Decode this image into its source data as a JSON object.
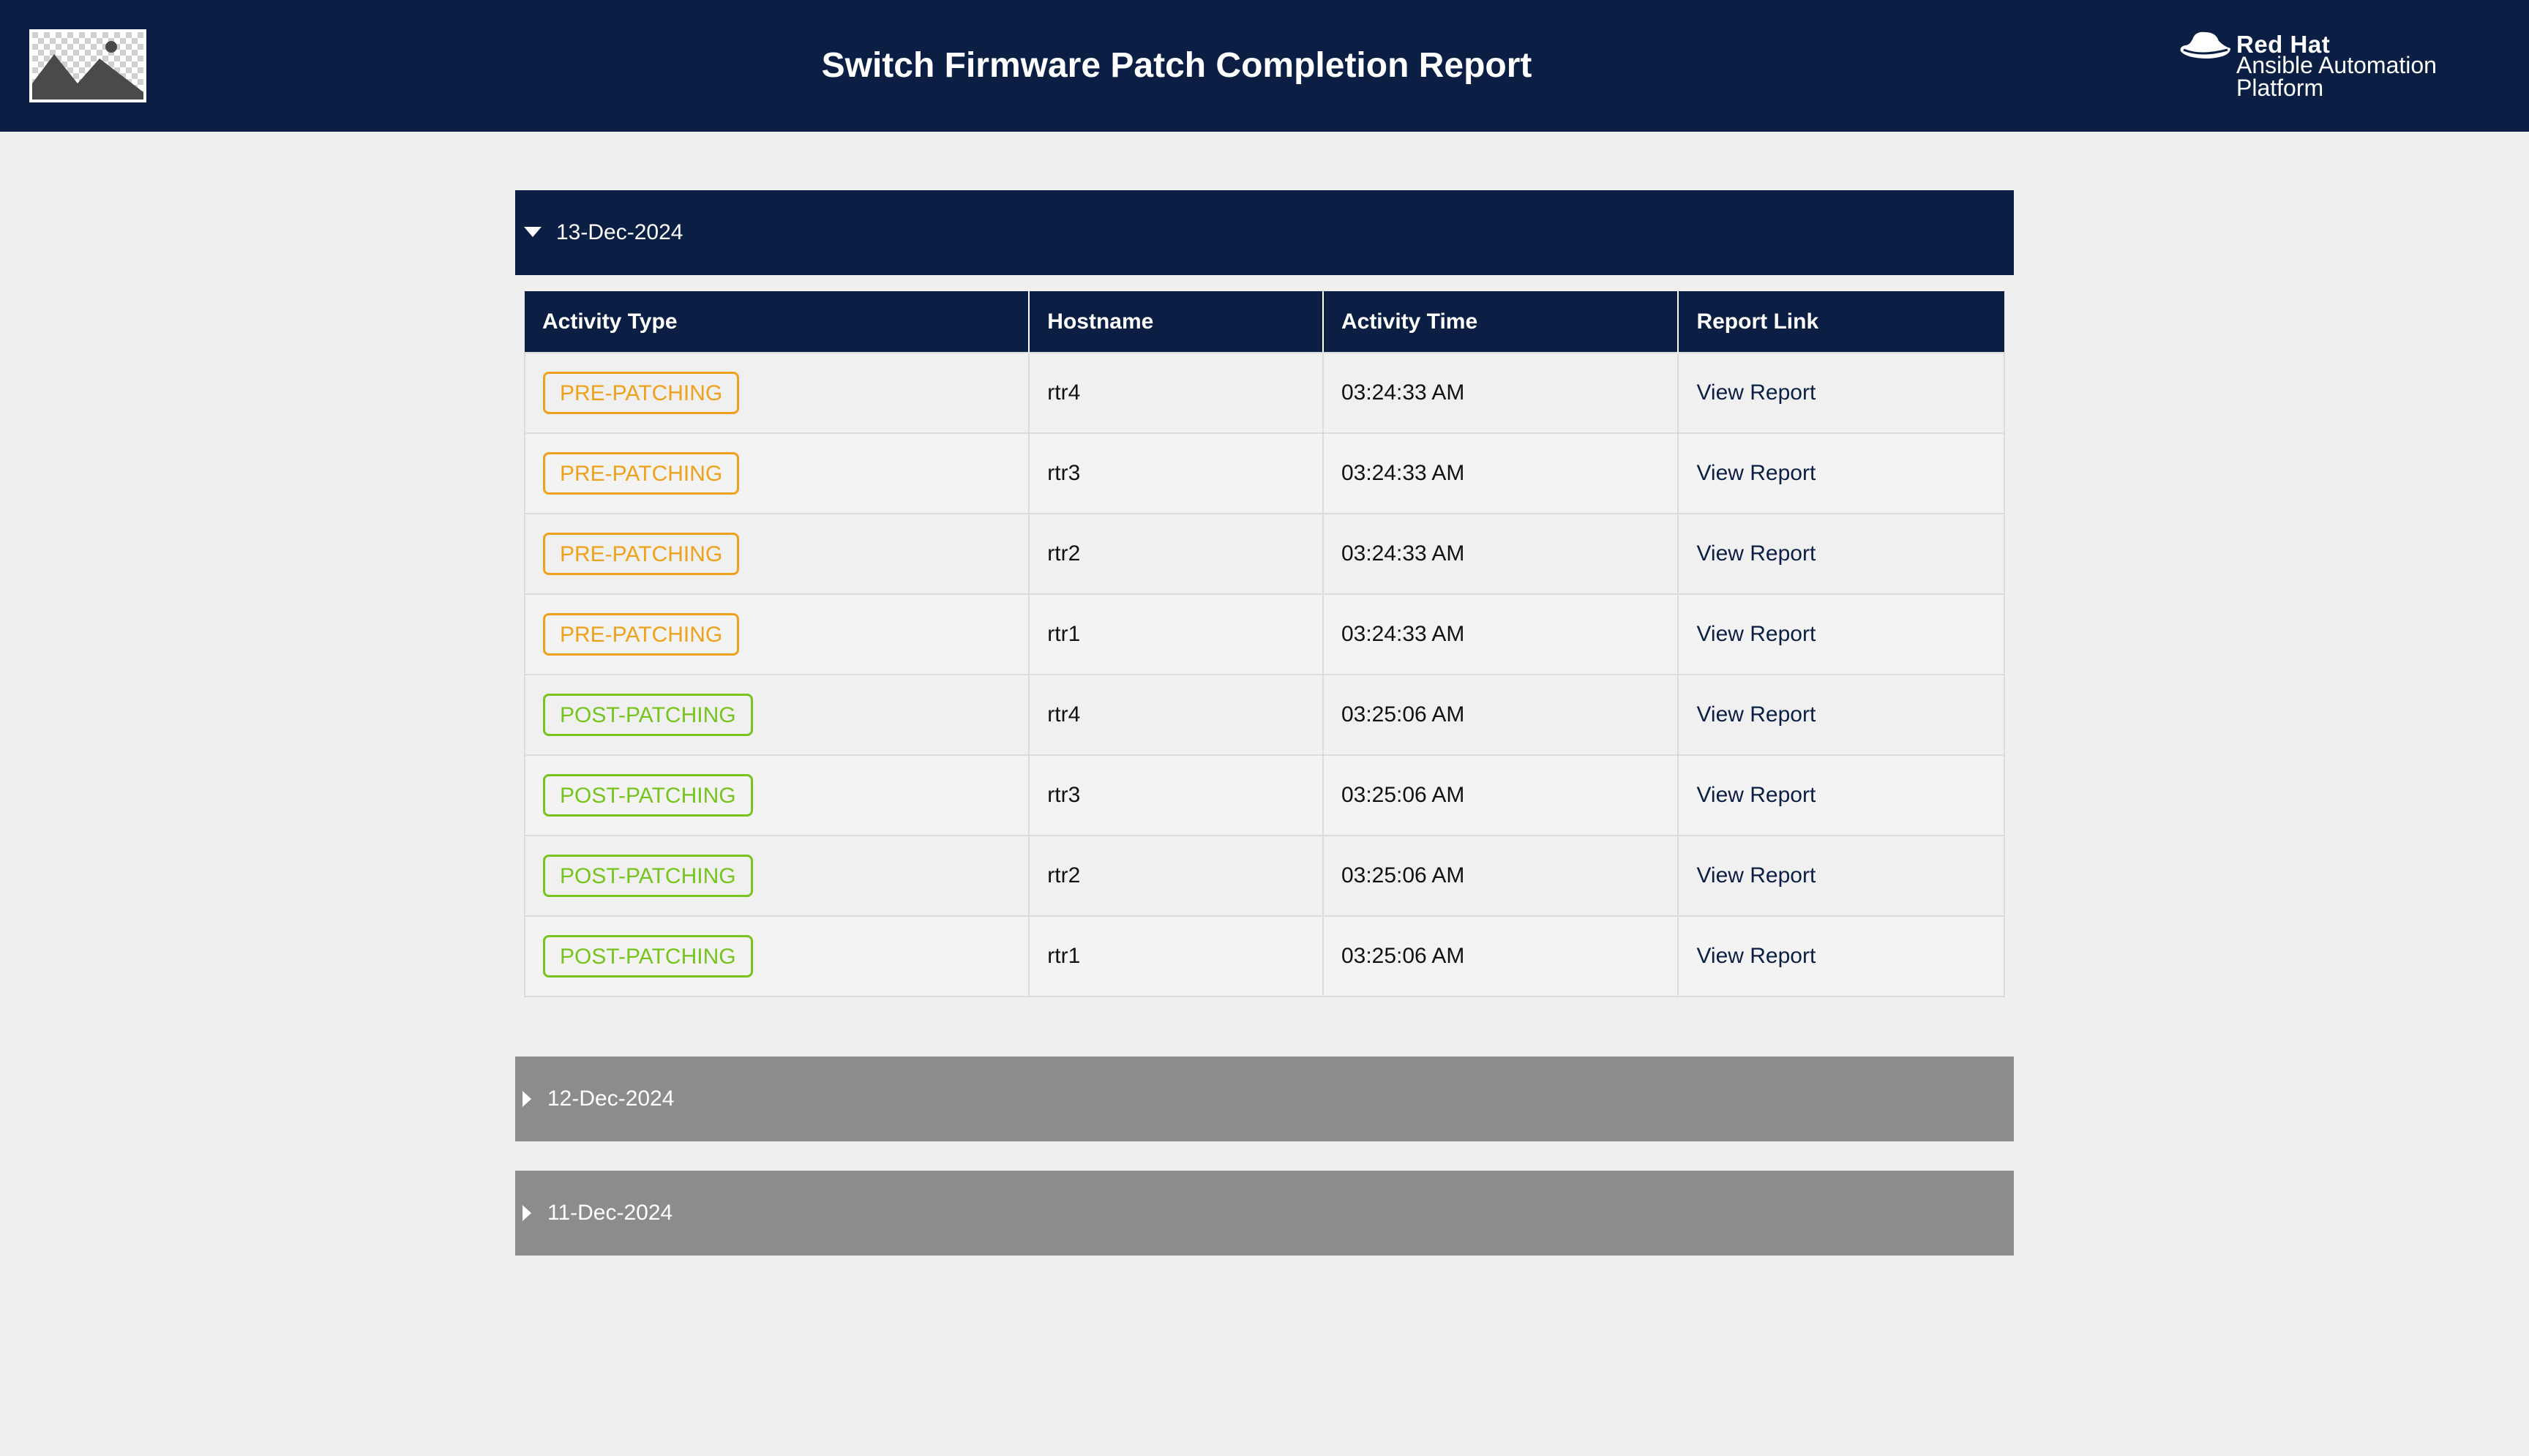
{
  "header": {
    "title": "Switch Firmware Patch Completion Report",
    "brand_name": "Red Hat",
    "brand_product": "Ansible Automation Platform",
    "logo_icon": "image-placeholder-icon"
  },
  "colors": {
    "navy": "#0b1f45",
    "collapsed_gray": "#8c8c8c",
    "pre_patching": "#f0a11c",
    "post_patching": "#77c41e"
  },
  "sections": [
    {
      "date": "13-Dec-2024",
      "expanded": true,
      "columns": [
        "Activity Type",
        "Hostname",
        "Activity Time",
        "Report Link"
      ],
      "rows": [
        {
          "activity": "PRE-PATCHING",
          "kind": "pre",
          "host": "rtr4",
          "time": "03:24:33 AM",
          "link": "View Report"
        },
        {
          "activity": "PRE-PATCHING",
          "kind": "pre",
          "host": "rtr3",
          "time": "03:24:33 AM",
          "link": "View Report"
        },
        {
          "activity": "PRE-PATCHING",
          "kind": "pre",
          "host": "rtr2",
          "time": "03:24:33 AM",
          "link": "View Report"
        },
        {
          "activity": "PRE-PATCHING",
          "kind": "pre",
          "host": "rtr1",
          "time": "03:24:33 AM",
          "link": "View Report"
        },
        {
          "activity": "POST-PATCHING",
          "kind": "post",
          "host": "rtr4",
          "time": "03:25:06 AM",
          "link": "View Report"
        },
        {
          "activity": "POST-PATCHING",
          "kind": "post",
          "host": "rtr3",
          "time": "03:25:06 AM",
          "link": "View Report"
        },
        {
          "activity": "POST-PATCHING",
          "kind": "post",
          "host": "rtr2",
          "time": "03:25:06 AM",
          "link": "View Report"
        },
        {
          "activity": "POST-PATCHING",
          "kind": "post",
          "host": "rtr1",
          "time": "03:25:06 AM",
          "link": "View Report"
        }
      ]
    },
    {
      "date": "12-Dec-2024",
      "expanded": false
    },
    {
      "date": "11-Dec-2024",
      "expanded": false
    }
  ]
}
